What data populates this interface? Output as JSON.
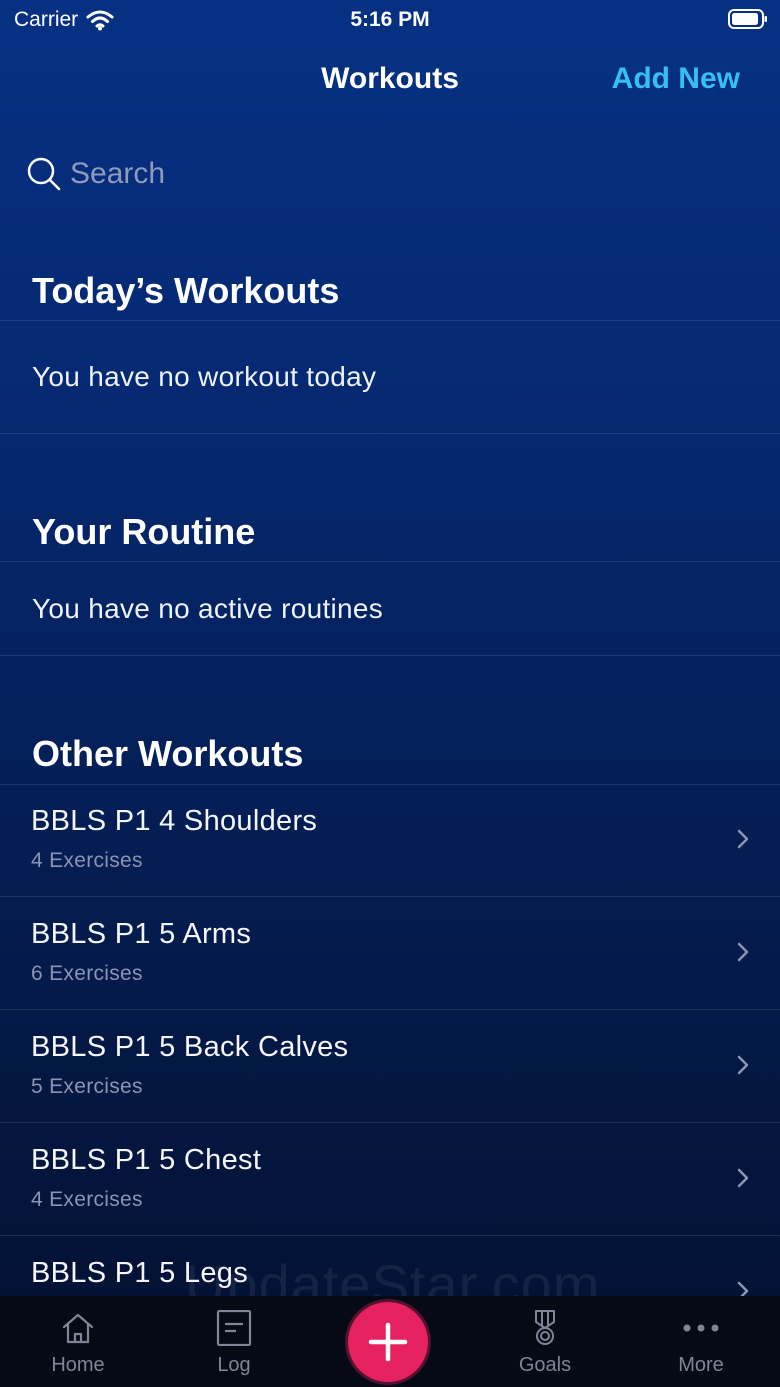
{
  "status_bar": {
    "carrier": "Carrier",
    "time": "5:16 PM"
  },
  "nav": {
    "title": "Workouts",
    "add_new": "Add New"
  },
  "search": {
    "placeholder": "Search"
  },
  "sections": {
    "today": {
      "title": "Today’s Workouts",
      "empty": "You have no workout today"
    },
    "routine": {
      "title": "Your Routine",
      "empty": "You have no active routines"
    },
    "other": {
      "title": "Other Workouts",
      "items": [
        {
          "name": "BBLS P1 4 Shoulders",
          "detail": "4 Exercises"
        },
        {
          "name": "BBLS P1 5 Arms",
          "detail": "6 Exercises"
        },
        {
          "name": "BBLS P1 5 Back Calves",
          "detail": "5 Exercises"
        },
        {
          "name": "BBLS P1 5 Chest",
          "detail": "4 Exercises"
        },
        {
          "name": "BBLS P1 5 Legs",
          "detail": ""
        }
      ]
    }
  },
  "watermark": "UpdateStar.com",
  "tab_bar": {
    "tabs": [
      {
        "label": "Home",
        "icon": "home-icon"
      },
      {
        "label": "Log",
        "icon": "log-icon"
      },
      {
        "label": "Goals",
        "icon": "medal-icon"
      },
      {
        "label": "More",
        "icon": "more-icon"
      }
    ],
    "fab_icon": "plus-icon"
  },
  "colors": {
    "accent": "#36bff4",
    "fab": "#e5225f",
    "background_top": "#063183",
    "background_bottom": "#030f2e"
  }
}
